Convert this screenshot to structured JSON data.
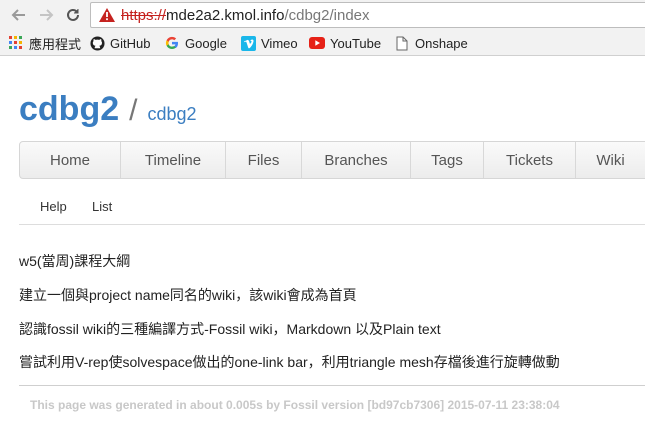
{
  "browser": {
    "url_scheme": "https://",
    "url_host": "mde2a2.kmol.info",
    "url_path": "/cdbg2/index"
  },
  "bookmarks": [
    {
      "label": "應用程式",
      "icon": "apps-grid-icon"
    },
    {
      "label": "GitHub",
      "icon": "github-icon"
    },
    {
      "label": "Google",
      "icon": "google-icon"
    },
    {
      "label": "Vimeo",
      "icon": "vimeo-icon"
    },
    {
      "label": "YouTube",
      "icon": "youtube-icon"
    },
    {
      "label": "Onshape",
      "icon": "page-icon"
    }
  ],
  "header": {
    "title": "cdbg2",
    "separator": "/",
    "subtitle": "cdbg2"
  },
  "mainmenu": [
    "Home",
    "Timeline",
    "Files",
    "Branches",
    "Tags",
    "Tickets",
    "Wiki"
  ],
  "submenu": [
    "Help",
    "List"
  ],
  "content": [
    "w5(當周)課程大綱",
    "建立一個與project name同名的wiki，該wiki會成為首頁",
    "認識fossil wiki的三種編譯方式-Fossil wiki，Markdown 以及Plain text",
    "嘗試利用V-rep使solvespace做出的one-link bar，利用triangle mesh存檔後進行旋轉做動"
  ],
  "footer": "This page was generated in about 0.005s by Fossil version [bd97cb7306] 2015-07-11 23:38:04",
  "colors": {
    "accent": "#3b7ec1",
    "warning": "#c5221f"
  }
}
